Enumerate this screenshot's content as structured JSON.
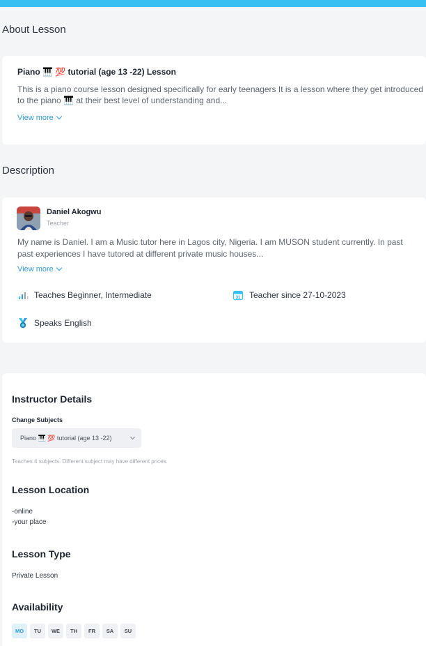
{
  "about": {
    "heading": "About Lesson",
    "title": "Piano 🎹 💯 tutorial (age 13 -22) Lesson",
    "body": "This is a piano course lesson designed specifically for early teenagers It is a lesson where they get introduced to the piano 🎹 at their best level of understanding and...",
    "view_more": "View more"
  },
  "description": {
    "heading": "Description",
    "teacher_name": "Daniel Akogwu",
    "teacher_role": "Teacher",
    "body_line1": "My name is Daniel. I am a Music tutor here in Lagos city, Nigeria. I am MUSON student currently. In past",
    "body_line2": "past experiences I have tutored at different private music houses...",
    "view_more": "View more",
    "features": {
      "teaches": "Teaches Beginner, Intermediate",
      "since": "Teacher since 27-10-2023",
      "speaks": "Speaks English"
    },
    "icons": {
      "teaches": "bar-chart-icon",
      "since": "calendar-icon",
      "speaks": "medal-icon"
    }
  },
  "instructor": {
    "heading": "Instructor Details",
    "change_subjects_label": "Change Subjects",
    "selected_subject": "Piano 🎹 💯 tutorial (age 13 -22)",
    "hint": "Teaches 4 subjects. Different subject may have different prices.",
    "location_heading": "Lesson Location",
    "location_line1": "-online",
    "location_line2": "-your place",
    "type_heading": "Lesson Type",
    "type_value": "Private Lesson",
    "availability_heading": "Availability",
    "days": [
      "MO",
      "TU",
      "WE",
      "TH",
      "FR",
      "SA",
      "SU"
    ],
    "active_day": "MO"
  },
  "colors": {
    "accent": "#38c0f2",
    "link": "#2e9bd8",
    "background": "#f4f5f7"
  }
}
